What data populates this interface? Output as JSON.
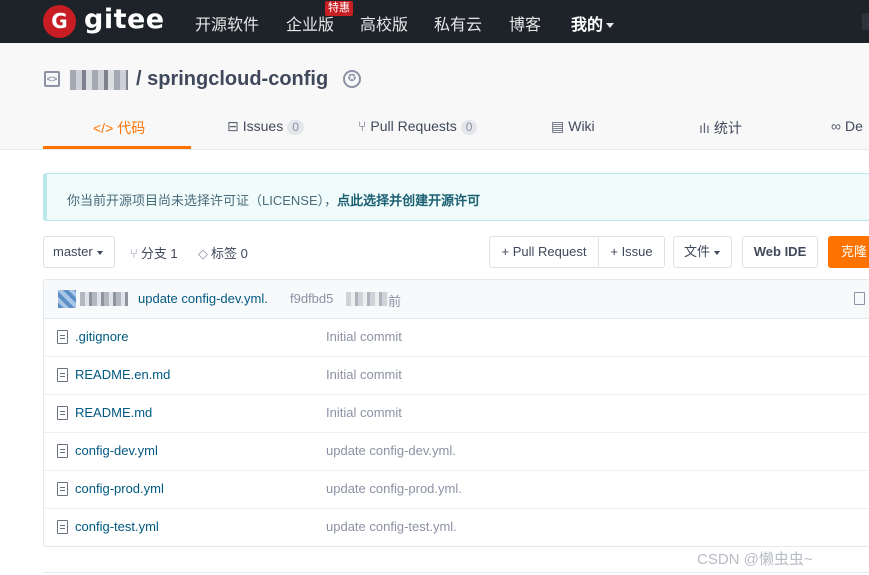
{
  "nav": {
    "logo_letter": "G",
    "logo_text": "gitee",
    "items": [
      "开源软件",
      "企业版",
      "高校版",
      "私有云",
      "博客",
      "我的"
    ],
    "badge": "特惠"
  },
  "repo": {
    "owner": "j***k",
    "title": "/ springcloud-config",
    "tabs": [
      {
        "label": "代码",
        "icon": "</>",
        "active": true
      },
      {
        "label": "Issues",
        "count": "0"
      },
      {
        "label": "Pull Requests",
        "count": "0"
      },
      {
        "label": "Wiki"
      },
      {
        "label": "统计"
      },
      {
        "label": "De"
      }
    ]
  },
  "notice": {
    "text": "你当前开源项目尚未选择许可证（LICENSE），",
    "link": "点此选择并创建开源许可"
  },
  "toolbar": {
    "branch": "master",
    "branches": "分支 1",
    "tags": "标签 0",
    "pull_request": "+ Pull Request",
    "issue": "+ Issue",
    "files": "文件",
    "web_ide": "Web IDE",
    "clone": "克隆"
  },
  "last_commit": {
    "message": "update config-dev.yml.",
    "sha": "f9dfbd5",
    "time_suffix": "前"
  },
  "files": [
    {
      "name": ".gitignore",
      "commit": "Initial commit"
    },
    {
      "name": "README.en.md",
      "commit": "Initial commit"
    },
    {
      "name": "README.md",
      "commit": "Initial commit"
    },
    {
      "name": "config-dev.yml",
      "commit": "update config-dev.yml."
    },
    {
      "name": "config-prod.yml",
      "commit": "update config-prod.yml."
    },
    {
      "name": "config-test.yml",
      "commit": "update config-test.yml."
    }
  ],
  "watermark": "CSDN @懒虫虫~",
  "colors": {
    "nav_bg": "#1e2229",
    "brand_red": "#c71d23",
    "accent_orange": "#fe7300",
    "link_blue": "#005980"
  }
}
